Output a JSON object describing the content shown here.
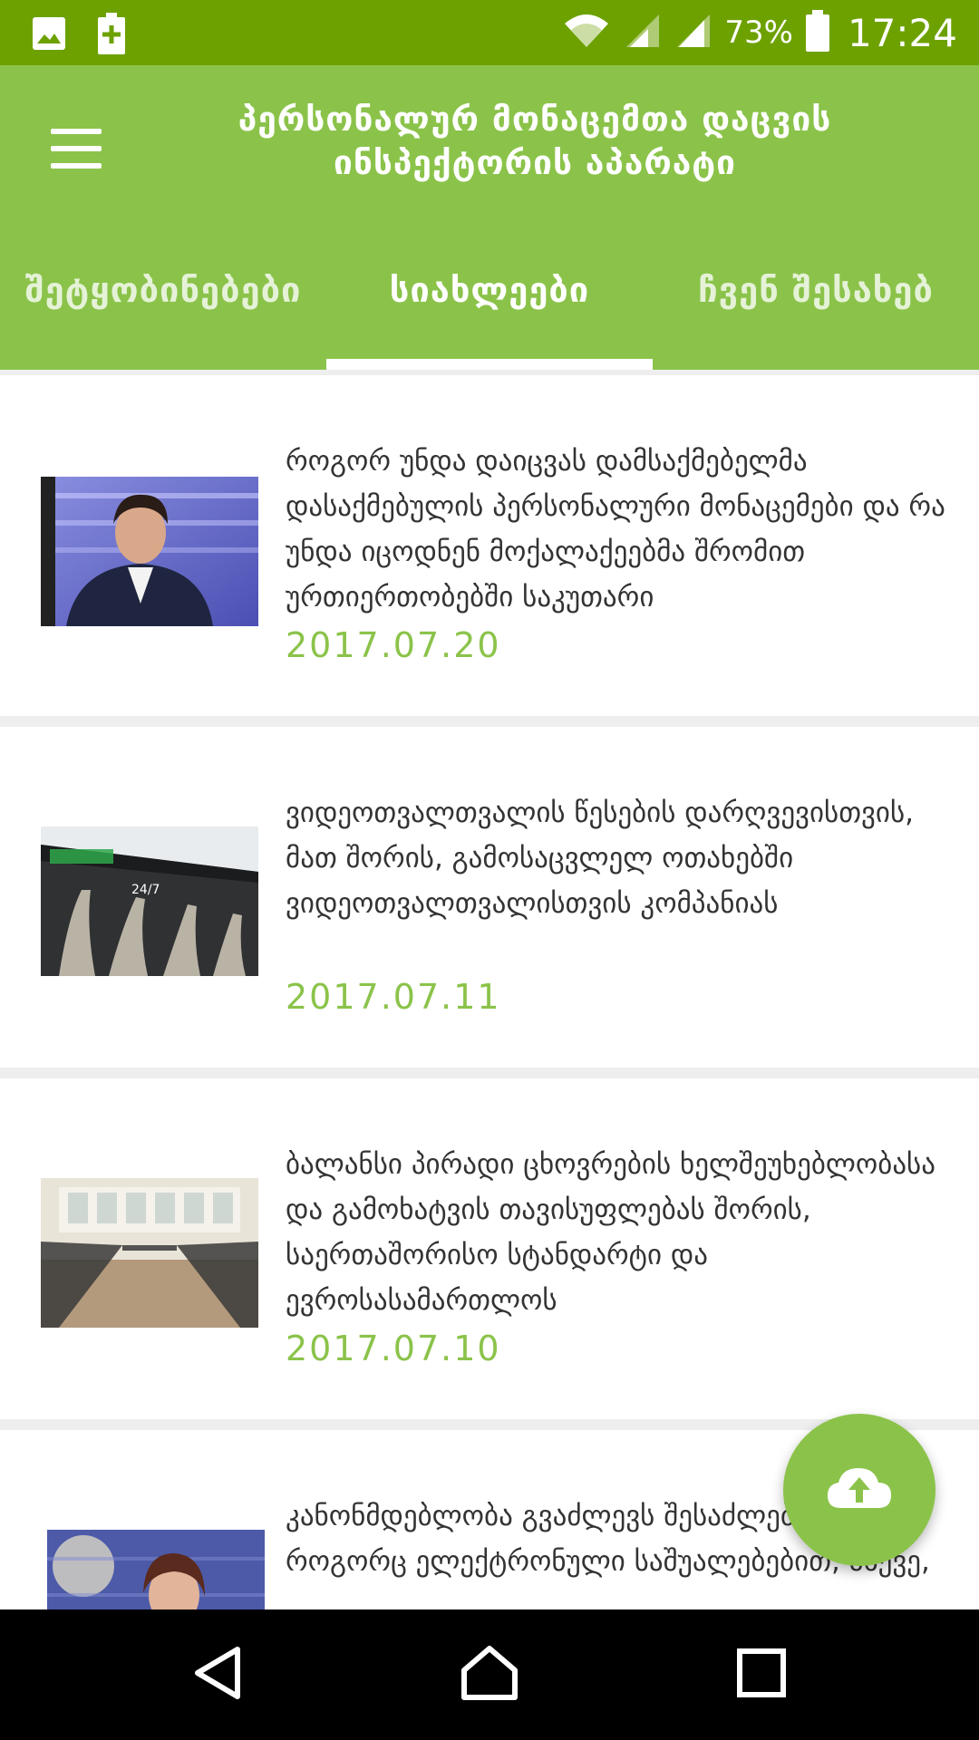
{
  "status_bar": {
    "left_icons": [
      "image-icon",
      "battery-charging-icon"
    ],
    "right_icons": [
      "wifi-icon",
      "signal-icon",
      "signal-icon",
      "battery-icon"
    ],
    "battery_percent": "73%",
    "time": "17:24"
  },
  "header": {
    "title_line1": "პერსონალურ მონაცემთა დაცვის",
    "title_line2": "ინსპექტორის აპარატი",
    "menu_icon": "menu-icon"
  },
  "tabs": [
    {
      "label": "შეტყობინებები",
      "active": false
    },
    {
      "label": "სიახლეები",
      "active": true
    },
    {
      "label": "ჩვენ შესახებ",
      "active": false
    }
  ],
  "news": [
    {
      "title": "როგორ უნდა დაიცვას დამსაქმებელმა დასაქმებულის პერსონალური მონაცემები და რა უნდა იცოდნენ მოქალაქეებმა შრომით ურთიერთობებში საკუთარი",
      "date": "2017.07.20"
    },
    {
      "title": "ვიდეოთვალთვალის წესების დარღვევისთვის, მათ შორის, გამოსაცვლელ ოთახებში ვიდეოთვალთვალისთვის კომპანიას",
      "date": "2017.07.11"
    },
    {
      "title": "ბალანსი პირადი ცხოვრების ხელშეუხებლობასა და გამოხატვის თავისუფლებას შორის,  საერთაშორისო სტანდარტი და ევროსასამართლოს",
      "date": "2017.07.10"
    },
    {
      "title": "კანონმდებლობა გვაძლევს შესაძლებლობას, როგორც ელექტრონული საშუალებებით, ასევე,",
      "date": ""
    }
  ],
  "thumbnail_sign_text": "24/7",
  "fab": {
    "icon": "cloud-upload-icon"
  },
  "colors": {
    "status_bar": "#6da100",
    "header": "#8bc34a",
    "accent": "#8bc34a"
  }
}
